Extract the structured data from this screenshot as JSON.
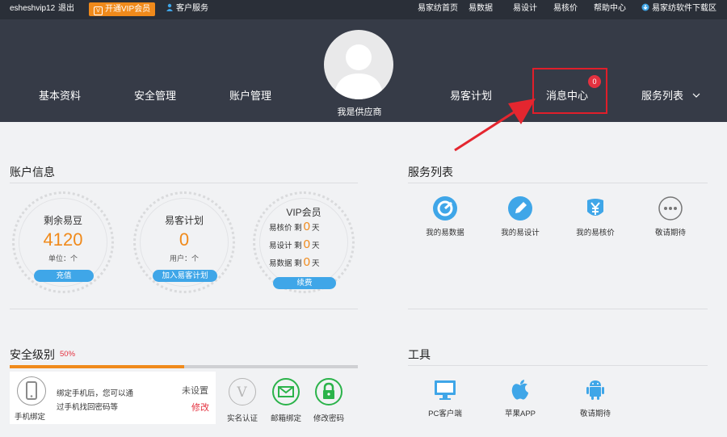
{
  "topbar": {
    "username": "esheshvip12",
    "logout": "退出",
    "vip_button": "开通VIP会员",
    "customer_service": "客户服务",
    "links": [
      "易家纺首页",
      "易数据",
      "易设计",
      "易核价",
      "帮助中心"
    ],
    "download": "易家纺软件下载区"
  },
  "nav": {
    "left": [
      "基本资料",
      "安全管理",
      "账户管理"
    ],
    "right": [
      "易客计划",
      "消息中心",
      "服务列表"
    ],
    "message_count": "0",
    "user_role": "我是供应商"
  },
  "account": {
    "title": "账户信息",
    "beans": {
      "title": "剩余易豆",
      "value": "4120",
      "unit": "单位：个",
      "button": "充值"
    },
    "plan": {
      "title": "易客计划",
      "value": "0",
      "unit": "用户：个",
      "button": "加入易客计划"
    },
    "vip": {
      "title": "VIP会员",
      "rows": [
        {
          "label": "易核价 剩",
          "value": "0",
          "suffix": "天"
        },
        {
          "label": "易设计 剩",
          "value": "0",
          "suffix": "天"
        },
        {
          "label": "易数据 剩",
          "value": "0",
          "suffix": "天"
        }
      ],
      "button": "续费"
    }
  },
  "services": {
    "title": "服务列表",
    "items": [
      {
        "label": "我的易数据",
        "icon": "chart-icon"
      },
      {
        "label": "我的易设计",
        "icon": "pencil-icon"
      },
      {
        "label": "我的易核价",
        "icon": "yuan-icon"
      },
      {
        "label": "敬请期待",
        "icon": "more-icon"
      }
    ]
  },
  "security": {
    "title": "安全级别",
    "level": "50%",
    "level_fraction": 0.5,
    "phone_label": "手机绑定",
    "phone_desc_1": "绑定手机后，您可以通",
    "phone_desc_2": "过手机找回密码等",
    "status": "未设置",
    "modify": "修改",
    "items": [
      "实名认证",
      "邮箱绑定",
      "修改密码"
    ]
  },
  "tools": {
    "title": "工具",
    "items": [
      {
        "label": "PC客户端",
        "icon": "monitor-icon"
      },
      {
        "label": "苹果APP",
        "icon": "apple-icon"
      },
      {
        "label": "敬请期待",
        "icon": "android-icon"
      }
    ]
  },
  "colors": {
    "accent": "#f08a1b",
    "blue": "#3fa6e8",
    "green": "#2bb34a",
    "header": "#363b47",
    "highlight": "#e01e2a"
  }
}
